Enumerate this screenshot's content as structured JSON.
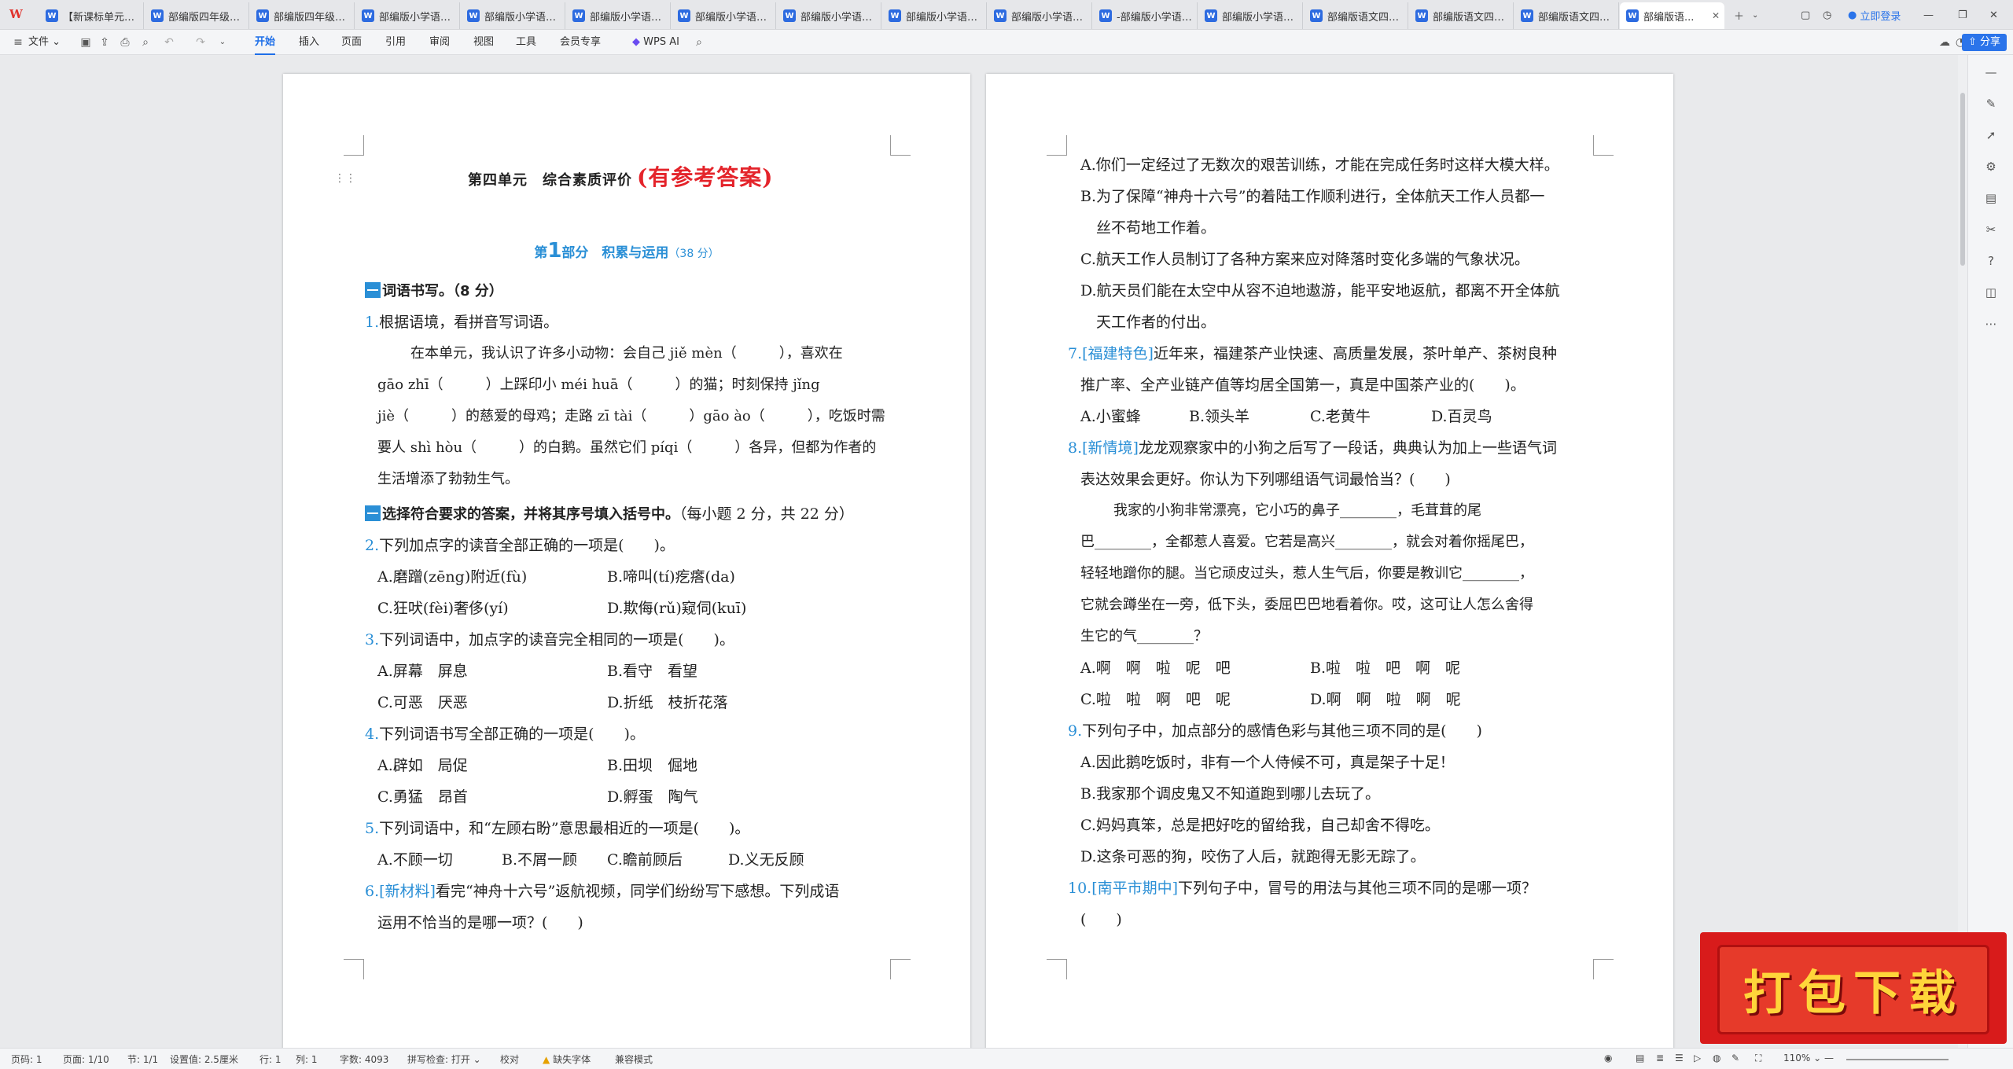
{
  "tabs": [
    {
      "label": "【新课标单元特..."
    },
    {
      "label": "部编版四年级下..."
    },
    {
      "label": "部编版四年级语..."
    },
    {
      "label": "部编版小学语文..."
    },
    {
      "label": "部编版小学语文..."
    },
    {
      "label": "部编版小学语文..."
    },
    {
      "label": "部编版小学语文..."
    },
    {
      "label": "部编版小学语文..."
    },
    {
      "label": "部编版小学语文..."
    },
    {
      "label": "部编版小学语文..."
    },
    {
      "label": "-部编版小学语文..."
    },
    {
      "label": "部编版小学语文..."
    },
    {
      "label": "部编版语文四年..."
    },
    {
      "label": "部编版语文四年..."
    },
    {
      "label": "部编版语文四年..."
    },
    {
      "label": "部编版语..."
    }
  ],
  "login": "立即登录",
  "ribbon": {
    "file": "文件",
    "items": [
      "开始",
      "插入",
      "页面",
      "引用",
      "审阅",
      "视图",
      "工具",
      "会员专享"
    ],
    "wps_ai": "WPS AI",
    "share": "分享"
  },
  "left": {
    "title": "第四单元　综合素质评价",
    "title_red": "(有参考答案)",
    "part_pre": "第",
    "part_num": "1",
    "part_post": "部分　积累与运用",
    "part_score": "（38 分）",
    "s1": "词语书写。（8 分）",
    "q1": "根据语境，看拼音写词语。",
    "p1": "在本单元，我认识了许多小动物：会自己 jiě mèn（　　　），喜欢在",
    "p2": "gāo zhī（　　　）上踩印小 méi huā（　　　）的猫；时刻保持 jǐng",
    "p3": "jiè（　　　）的慈爱的母鸡；走路 zī tài（　　　）gāo ào（　　　），吃饭时需",
    "p4": "要人 shì hòu（　　　）的白鹅。虽然它们 píqi（　　　）各异，但都为作者的",
    "p5": "生活增添了勃勃生气。",
    "s2": "选择符合要求的答案，并将其序号填入括号中。",
    "s2b": "（每小题 2 分，共 22 分）",
    "q2": "下列加点字的读音全部正确的一项是(　　)。",
    "q2a": "A.磨蹭(zēng)附近(fù)",
    "q2b": "B.啼叫(tí)疙瘩(da)",
    "q2c": "C.狂吠(fèi)奢侈(yí)",
    "q2d": "D.欺侮(rǔ)窥伺(kuī)",
    "q3": "下列词语中，加点字的读音完全相同的一项是(　　)。",
    "q3a": "A.屏幕　屏息",
    "q3b": "B.看守　看望",
    "q3c": "C.可恶　厌恶",
    "q3d": "D.折纸　枝折花落",
    "q4": "下列词语书写全部正确的一项是(　　)。",
    "q4a": "A.辟如　局促",
    "q4b": "B.田坝　倔地",
    "q4c": "C.勇猛　昂首",
    "q4d": "D.孵蛋　陶气",
    "q5": "下列词语中，和“左顾右盼”意思最相近的一项是(　　)。",
    "q5a": "A.不顾一切",
    "q5b": "B.不屑一顾",
    "q5c": "C.瞻前顾后",
    "q5d": "D.义无反顾",
    "q6tag": "[新材料]",
    "q6": "看完“神舟十六号”返航视频，同学们纷纷写下感想。下列成语",
    "q6b": "运用不恰当的是哪一项？(　　)"
  },
  "right": {
    "a": "A.你们一定经过了无数次的艰苦训练，才能在完成任务时这样大模大样。",
    "b1": "B.为了保障“神舟十六号”的着陆工作顺利进行，全体航天工作人员都一",
    "b2": "丝不苟地工作着。",
    "c": "C.航天工作人员制订了各种方案来应对降落时变化多端的气象状况。",
    "d1": "D.航天员们能在太空中从容不迫地遨游，能平安地返航，都离不开全体航",
    "d2": "天工作者的付出。",
    "q7tag": "[福建特色]",
    "q7": "近年来，福建茶产业快速、高质量发展，茶叶单产、茶树良种",
    "q7b": "推广率、全产业链产值等均居全国第一，真是中国茶产业的(　　)。",
    "q7a": "A.小蜜蜂",
    "q7bb": "B.领头羊",
    "q7c": "C.老黄牛",
    "q7d": "D.百灵鸟",
    "q8tag": "[新情境]",
    "q8": "龙龙观察家中的小狗之后写了一段话，典典认为加上一些语气词",
    "q8b": "表达效果会更好。你认为下列哪组语气词最恰当？(　　)",
    "p1": "我家的小狗非常漂亮，它小巧的鼻子________，毛茸茸的尾",
    "p2": "巴________，全都惹人喜爱。它若是高兴________，就会对着你摇尾巴，",
    "p3": "轻轻地蹭你的腿。当它顽皮过头，惹人生气后，你要是教训它________，",
    "p4": "它就会蹲坐在一旁，低下头，委屈巴巴地看着你。哎，这可让人怎么舍得",
    "p5": "生它的气________？",
    "q8a": "A.啊　啊　啦　呢　吧",
    "q8bb": "B.啦　啦　吧　啊　呢",
    "q8c": "C.啦　啦　啊　吧　呢",
    "q8d": "D.啊　啊　啦　啊　呢",
    "q9": "下列句子中，加点部分的感情色彩与其他三项不同的是(　　)",
    "q9a": "A.因此鹅吃饭时，非有一个人侍候不可，真是架子十足！",
    "q9b": "B.我家那个调皮鬼又不知道跑到哪儿去玩了。",
    "q9c": "C.妈妈真笨，总是把好吃的留给我，自己却舍不得吃。",
    "q9d": "D.这条可恶的狗，咬伤了人后，就跑得无影无踪了。",
    "q10tag": "[南平市期中]",
    "q10": "下列句子中，冒号的用法与其他三项不同的是哪一项？",
    "q10b": "(　　)"
  },
  "status": {
    "page": "页码: 1",
    "pages": "页面: 1/10",
    "section": "节: 1/1",
    "setting": "设置值: 2.5厘米",
    "row": "行: 1",
    "col": "列: 1",
    "words": "字数: 4093",
    "spell": "拼写检查: 打开",
    "proof": "校对",
    "font": "缺失字体",
    "compat": "兼容模式",
    "zoom": "110%"
  },
  "promo": "打包下载"
}
